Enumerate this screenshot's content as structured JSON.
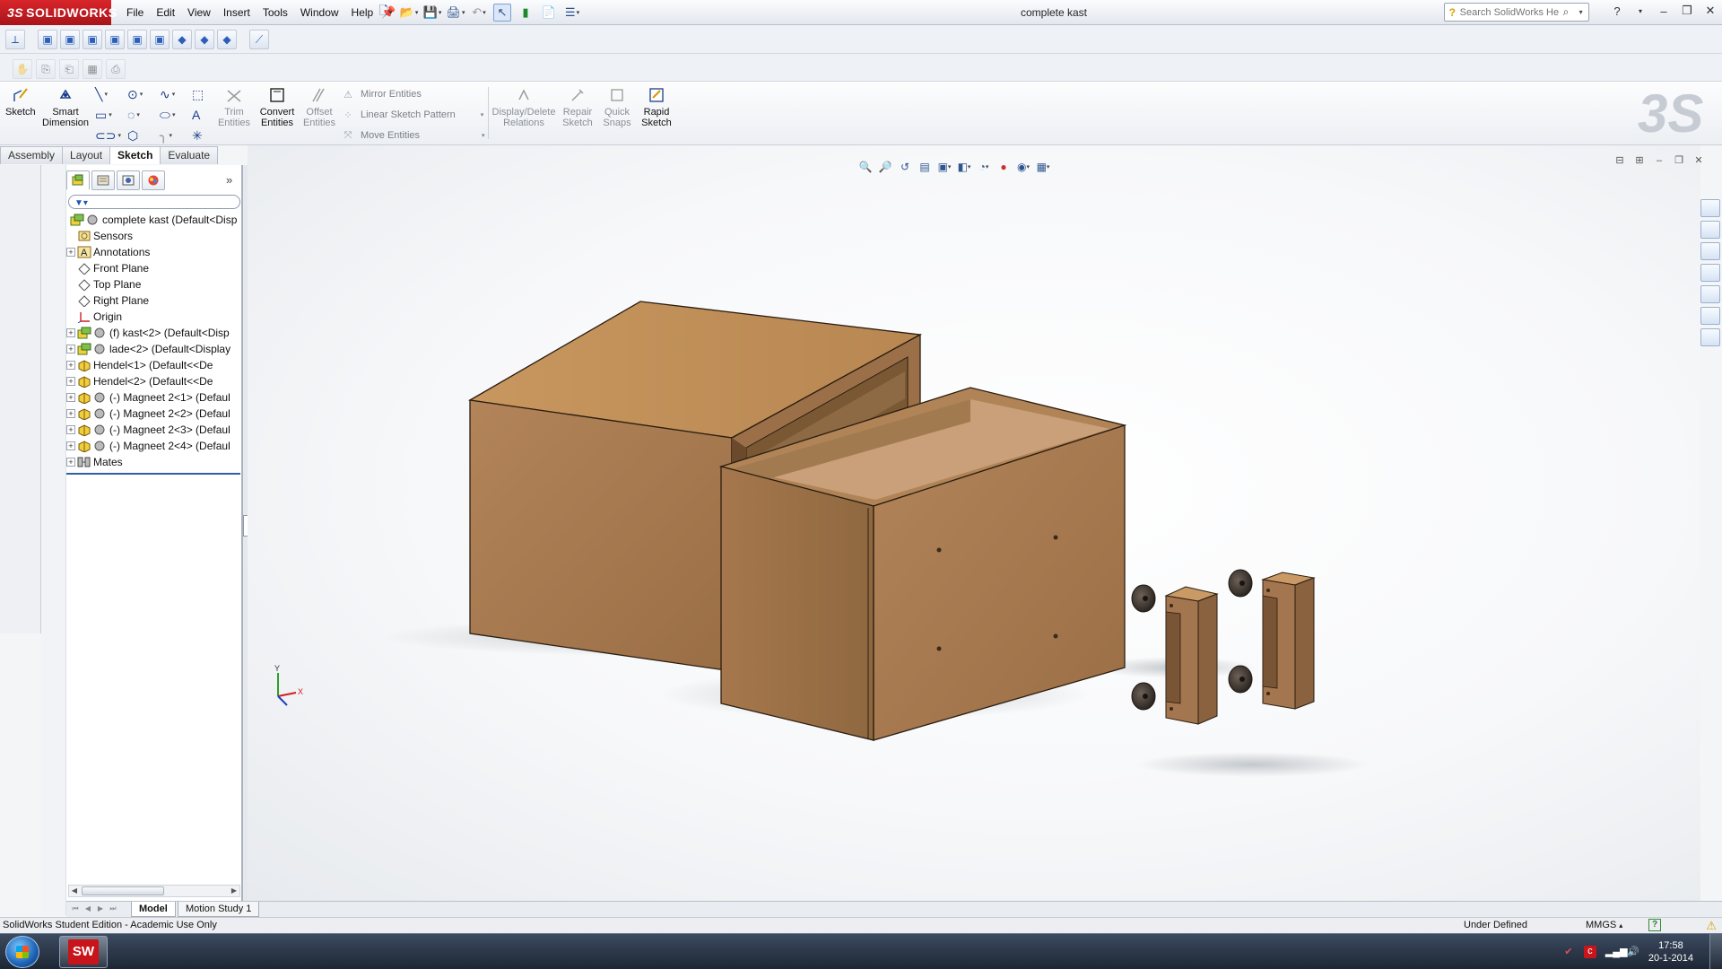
{
  "app": {
    "logo_ds": "3S",
    "logo_text": "SOLIDWORKS",
    "menu": [
      "File",
      "Edit",
      "View",
      "Insert",
      "Tools",
      "Window",
      "Help"
    ],
    "document_title": "complete kast",
    "search_placeholder": "Search SolidWorks Help"
  },
  "command_manager": {
    "sketch": "Sketch",
    "smart_dimension": "Smart Dimension",
    "trim_entities": "Trim Entities",
    "convert_entities": "Convert Entities",
    "offset_entities": "Offset Entities",
    "mirror_entities": "Mirror Entities",
    "linear_sketch_pattern": "Linear Sketch Pattern",
    "move_entities": "Move Entities",
    "display_delete_relations": "Display/Delete Relations",
    "repair_sketch": "Repair Sketch",
    "quick_snaps": "Quick Snaps",
    "rapid_sketch": "Rapid Sketch"
  },
  "cm_tabs": [
    "Assembly",
    "Layout",
    "Sketch",
    "Evaluate"
  ],
  "cm_active_tab": "Sketch",
  "tree": {
    "root": "complete kast  (Default<Disp",
    "items": [
      {
        "label": "Sensors",
        "icon": "sensor-icon",
        "expand": false
      },
      {
        "label": "Annotations",
        "icon": "annotation-icon",
        "expand": true
      },
      {
        "label": "Front Plane",
        "icon": "plane-icon",
        "expand": false
      },
      {
        "label": "Top Plane",
        "icon": "plane-icon",
        "expand": false
      },
      {
        "label": "Right Plane",
        "icon": "plane-icon",
        "expand": false
      },
      {
        "label": "Origin",
        "icon": "origin-icon",
        "expand": false
      },
      {
        "label": "(f) kast<2> (Default<Disp",
        "icon": "assembly-component-icon",
        "expand": true
      },
      {
        "label": "lade<2> (Default<Display",
        "icon": "assembly-component-icon",
        "expand": true
      },
      {
        "label": "Hendel<1> (Default<<De",
        "icon": "part-icon",
        "expand": true
      },
      {
        "label": "Hendel<2> (Default<<De",
        "icon": "part-icon",
        "expand": true
      },
      {
        "label": "(-) Magneet 2<1> (Defaul",
        "icon": "part-icon",
        "expand": true
      },
      {
        "label": "(-) Magneet 2<2> (Defaul",
        "icon": "part-icon",
        "expand": true
      },
      {
        "label": "(-) Magneet 2<3> (Defaul",
        "icon": "part-icon",
        "expand": true
      },
      {
        "label": "(-) Magneet 2<4> (Defaul",
        "icon": "part-icon",
        "expand": true
      },
      {
        "label": "Mates",
        "icon": "mates-icon",
        "expand": true
      }
    ]
  },
  "bottom_tabs": [
    "Model",
    "Motion Study 1"
  ],
  "status": {
    "edition": "SolidWorks Student Edition - Academic Use Only",
    "state": "Under Defined",
    "units": "MMGS",
    "help": "?"
  },
  "triad": {
    "x": "X",
    "y": "Y"
  },
  "taskbar": {
    "app_label": "SW",
    "time": "17:58",
    "date": "20-1-2014"
  },
  "colors": {
    "wood_front": "#a5784d",
    "wood_top": "#c7955f",
    "wood_dark": "#7a5530",
    "brand_red": "#c8141b"
  }
}
